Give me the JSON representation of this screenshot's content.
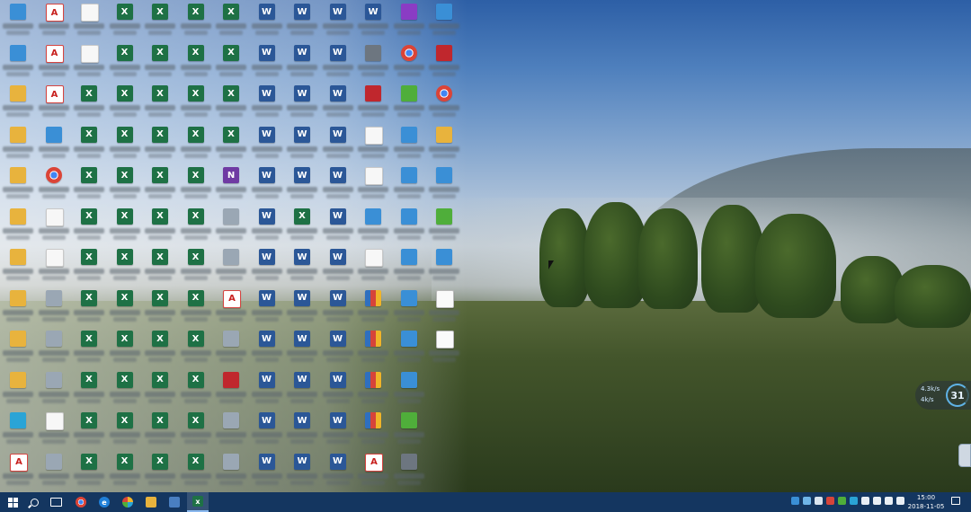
{
  "desktop": {
    "net_widget": {
      "up": "4.3k/s",
      "down": "4k/s",
      "percent": "31"
    }
  },
  "taskbar": {
    "clock_time": "15:00",
    "clock_date": "2018-11-05",
    "pinned": [
      {
        "name": "chrome",
        "glyph": ""
      },
      {
        "name": "edge",
        "glyph": "e"
      },
      {
        "name": "qq-browser",
        "glyph": ""
      },
      {
        "name": "file-explorer",
        "glyph": ""
      },
      {
        "name": "remote-desktop",
        "glyph": ""
      },
      {
        "name": "excel",
        "glyph": "x"
      }
    ]
  },
  "icons": [
    [
      "app",
      "pdf",
      "blank",
      "excel",
      "excel",
      "excel",
      "excel",
      "word",
      "word",
      "word",
      "word",
      "purple",
      "app"
    ],
    [
      "app",
      "pdf",
      "blank",
      "excel",
      "excel",
      "excel",
      "excel",
      "word",
      "word",
      "word",
      "gray",
      "chrome",
      "red"
    ],
    [
      "folder",
      "pdf",
      "excel",
      "excel",
      "excel",
      "excel",
      "excel",
      "word",
      "word",
      "word",
      "red",
      "green",
      "chrome"
    ],
    [
      "folder",
      "app",
      "excel",
      "excel",
      "excel",
      "excel",
      "excel",
      "word",
      "word",
      "word",
      "blank",
      "app",
      "folder"
    ],
    [
      "folder",
      "chrome",
      "excel",
      "excel",
      "excel",
      "excel",
      "note",
      "word",
      "word",
      "word",
      "blank",
      "app",
      "app"
    ],
    [
      "folder",
      "blank",
      "excel",
      "excel",
      "excel",
      "excel",
      "img",
      "word",
      "excel",
      "word",
      "app",
      "app",
      "green"
    ],
    [
      "folder",
      "blank",
      "excel",
      "excel",
      "excel",
      "excel",
      "img",
      "word",
      "word",
      "word",
      "blank",
      "app",
      "app"
    ],
    [
      "folder",
      "img",
      "excel",
      "excel",
      "excel",
      "excel",
      "pdf",
      "word",
      "word",
      "word",
      "zip",
      "app",
      "txt"
    ],
    [
      "folder",
      "img",
      "excel",
      "excel",
      "excel",
      "excel",
      "img",
      "word",
      "word",
      "word",
      "zip",
      "app",
      "txt"
    ],
    [
      "folder",
      "img",
      "excel",
      "excel",
      "excel",
      "excel",
      "red",
      "word",
      "word",
      "word",
      "zip",
      "app",
      ""
    ],
    [
      "cyan",
      "blank",
      "excel",
      "excel",
      "excel",
      "excel",
      "img",
      "word",
      "word",
      "word",
      "zip",
      "green",
      ""
    ],
    [
      "pdf",
      "img",
      "excel",
      "excel",
      "excel",
      "excel",
      "img",
      "word",
      "word",
      "word",
      "pdf",
      "gray",
      ""
    ]
  ]
}
